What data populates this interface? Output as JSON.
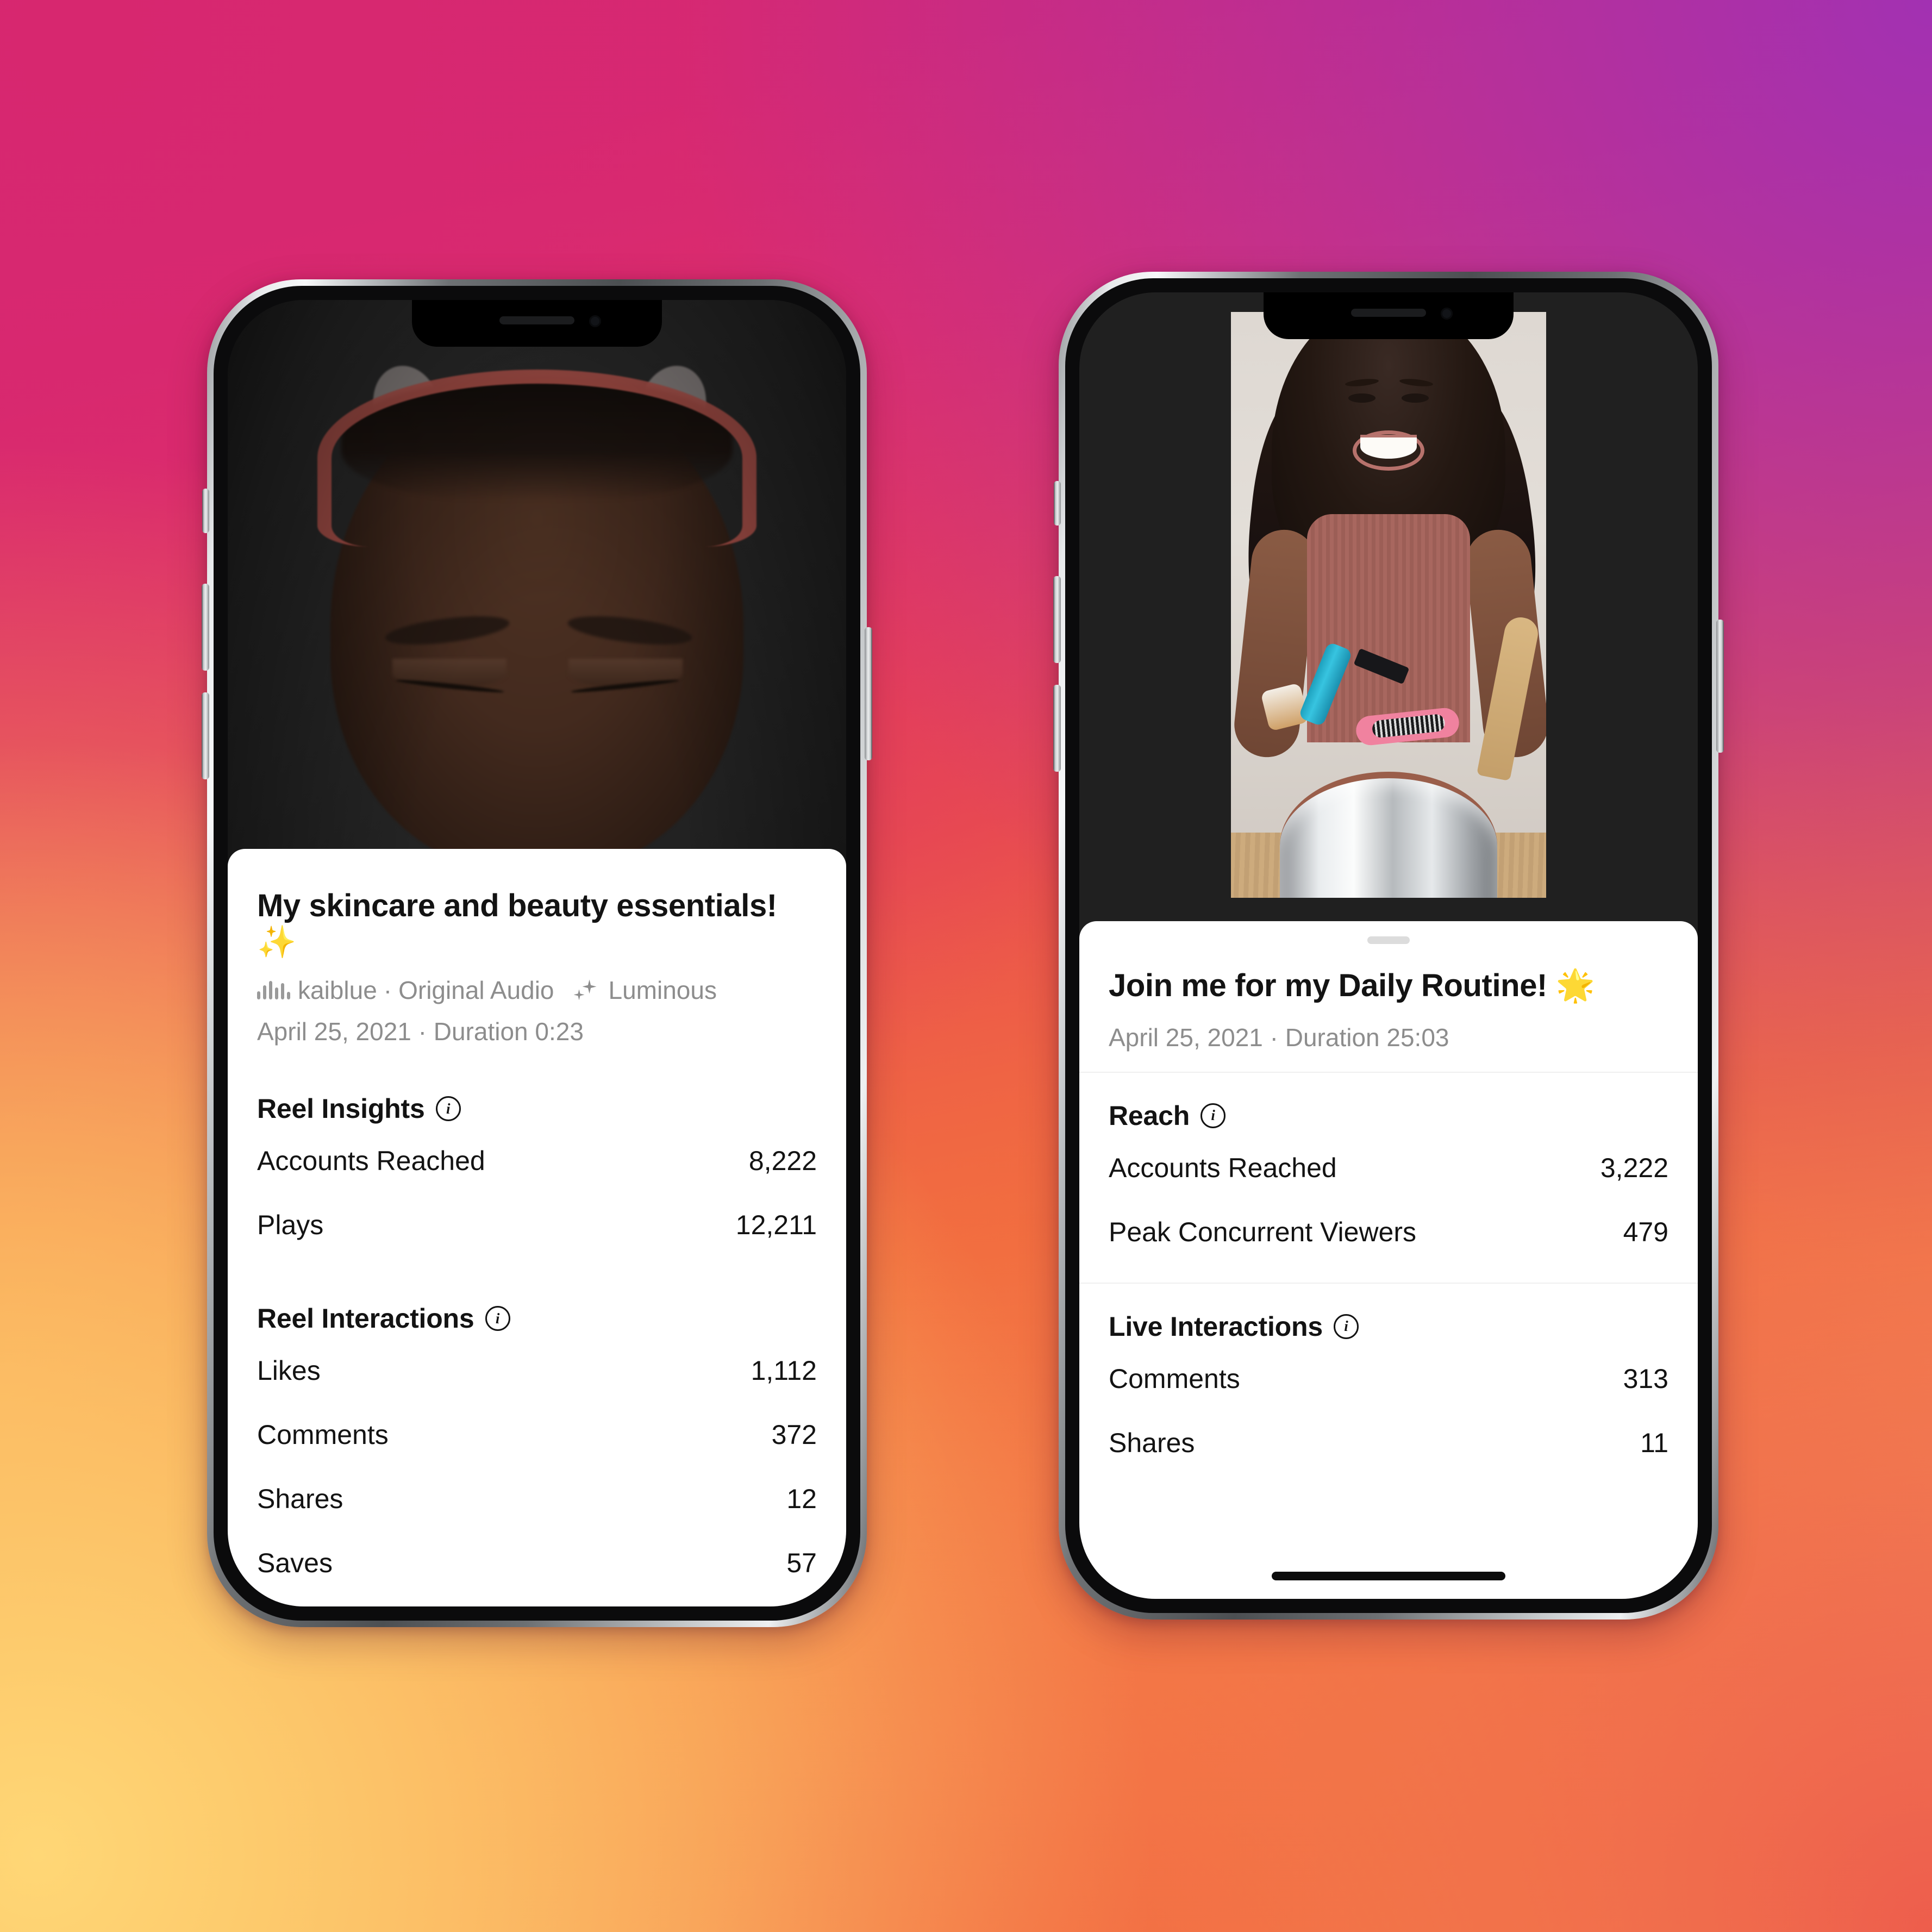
{
  "background": {
    "colors": {
      "top_left_pink": "#D7276F",
      "top_right_purple": "#A231B2",
      "mid_left_orange": "#F89A4E",
      "bottom_left_yellow": "#FDCD70",
      "bottom_right_coral": "#EC5A50"
    }
  },
  "phones": [
    {
      "id": "reel-insights-phone",
      "media": {
        "type": "reel-video",
        "description": "dark close-up of face with pink cat-ear headband"
      },
      "sheet": {
        "grabber": "drag-handle",
        "title": "My skincare and beauty essentials! ✨",
        "audio_icon": "audio-waveform-icon",
        "audio_author": "kaiblue",
        "audio_separator": "·",
        "audio_track": "Original Audio",
        "effect_icon": "sparkle-icon",
        "effect_name": "Luminous",
        "date_duration": "April 25, 2021 · Duration 0:23",
        "sections": [
          {
            "title": "Reel Insights",
            "info_icon": "info-icon",
            "info_glyph": "i",
            "rows": [
              {
                "label": "Accounts Reached",
                "value": "8,222"
              },
              {
                "label": "Plays",
                "value": "12,211"
              }
            ]
          },
          {
            "title": "Reel Interactions",
            "info_icon": "info-icon",
            "info_glyph": "i",
            "rows": [
              {
                "label": "Likes",
                "value": "1,112"
              },
              {
                "label": "Comments",
                "value": "372"
              },
              {
                "label": "Shares",
                "value": "12"
              },
              {
                "label": "Saves",
                "value": "57"
              }
            ]
          }
        ]
      }
    },
    {
      "id": "live-insights-phone",
      "media": {
        "type": "live-video",
        "description": "woman smiling holding beauty products over a pot"
      },
      "sheet": {
        "grabber": "drag-handle",
        "title": "Join me for my Daily Routine! 🌟",
        "date_duration": "April 25, 2021 · Duration 25:03",
        "sections": [
          {
            "title": "Reach",
            "info_icon": "info-icon",
            "info_glyph": "i",
            "rows": [
              {
                "label": "Accounts Reached",
                "value": "3,222"
              },
              {
                "label": "Peak Concurrent Viewers",
                "value": "479"
              }
            ]
          },
          {
            "title": "Live Interactions",
            "info_icon": "info-icon",
            "info_glyph": "i",
            "rows": [
              {
                "label": "Comments",
                "value": "313"
              },
              {
                "label": "Shares",
                "value": "11"
              }
            ]
          }
        ]
      }
    }
  ]
}
